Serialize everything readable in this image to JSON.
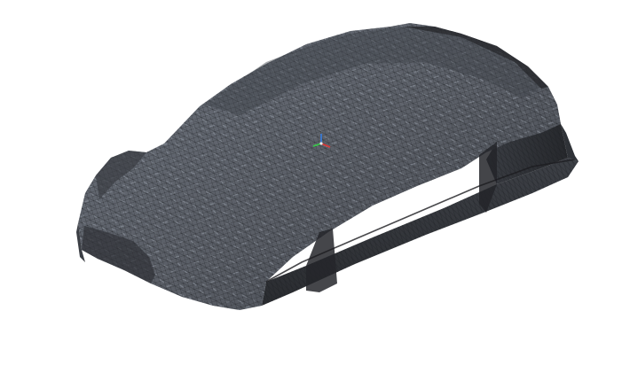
{
  "viewport": {
    "background": "#ffffff"
  },
  "model": {
    "shape": "car-body-mesh",
    "render_mode": "wireframe-on-shaded",
    "fill_color": "#5a5e66",
    "shadow_color": "#33363c",
    "dark_color": "#2b2d31",
    "highlight_color": "#8a929c",
    "wire_color": "#1f2024"
  },
  "gizmo": {
    "icon": "axis-triad-icon",
    "x_color": "#d43a3a",
    "y_color": "#3ac24a",
    "z_color": "#3a7ad4"
  }
}
